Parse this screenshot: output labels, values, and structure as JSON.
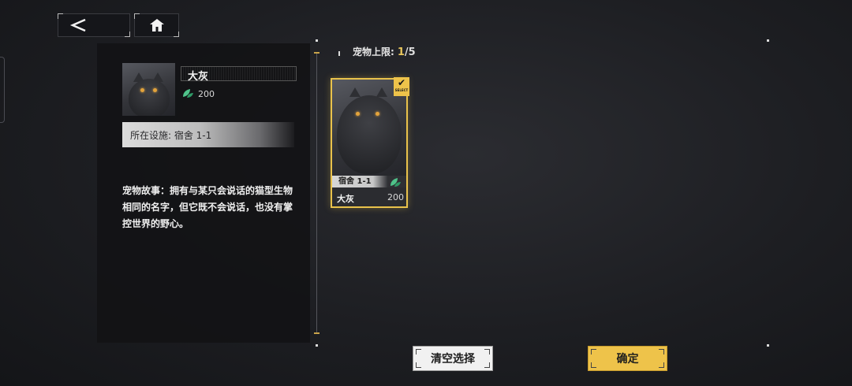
{
  "nav": {
    "back_icon": "chevron-left-icon",
    "home_icon": "home-icon"
  },
  "pet": {
    "name": "大灰",
    "value": "200",
    "value_icon": "leaf-icon",
    "facility": "所在设施: 宿舍 1-1",
    "story": "宠物故事：拥有与某只会说话的猫型生物相同的名字，但它既不会说话，也没有掌控世界的野心。"
  },
  "limit": {
    "label": "宠物上限:",
    "current": "1",
    "separator": "/",
    "max": "5"
  },
  "card": {
    "facility": "宿舍 1-1",
    "name": "大灰",
    "value": "200",
    "badge": "SELECT",
    "selected": true
  },
  "buttons": {
    "clear": "清空选择",
    "confirm": "确定"
  },
  "colors": {
    "accent": "#eec34a",
    "panel": "#121215",
    "leaf": "#4fc38a"
  }
}
